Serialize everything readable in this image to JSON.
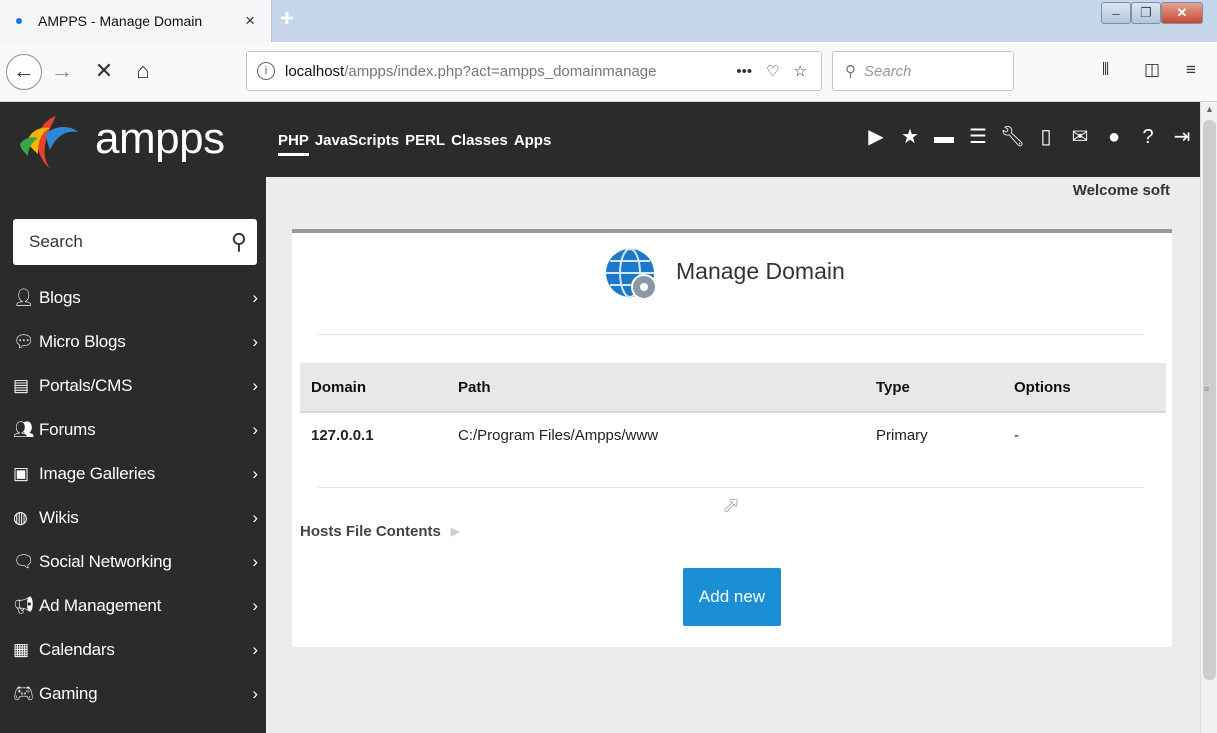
{
  "browser": {
    "tab_title": "AMPPS - Manage Domain",
    "tab_close": "×",
    "new_tab": "+",
    "url_host": "localhost",
    "url_path": "/ampps/index.php?act=ampps_domainmanage",
    "search_placeholder": "Search",
    "icons": [
      "back-icon",
      "forward-icon",
      "stop-icon",
      "home-icon",
      "info-icon",
      "page-actions-icon",
      "pocket-icon",
      "bookmark-star-icon",
      "search-icon",
      "library-icon",
      "sidebar-icon",
      "menu-icon"
    ]
  },
  "header": {
    "logo_text": "ampps",
    "nav": [
      "PHP",
      "JavaScripts",
      "PERL",
      "Classes",
      "Apps"
    ],
    "active_nav": "PHP",
    "icons": [
      "play-icon",
      "star-icon",
      "archive-icon",
      "list-icon",
      "wrench-icon",
      "file-icon",
      "mail-icon",
      "palette-icon",
      "help-icon",
      "logout-icon"
    ]
  },
  "sidebar": {
    "search_placeholder": "Search",
    "items": [
      {
        "label": "Blogs",
        "icon": "user-icon"
      },
      {
        "label": "Micro Blogs",
        "icon": "chat-bubbles-icon"
      },
      {
        "label": "Portals/CMS",
        "icon": "list-box-icon"
      },
      {
        "label": "Forums",
        "icon": "group-icon"
      },
      {
        "label": "Image Galleries",
        "icon": "image-icon"
      },
      {
        "label": "Wikis",
        "icon": "globe-icon"
      },
      {
        "label": "Social Networking",
        "icon": "comments-icon"
      },
      {
        "label": "Ad Management",
        "icon": "megaphone-icon"
      },
      {
        "label": "Calendars",
        "icon": "calendar-icon"
      },
      {
        "label": "Gaming",
        "icon": "gamepad-icon"
      }
    ]
  },
  "main": {
    "welcome": "Welcome soft",
    "title": "Manage Domain",
    "table": {
      "headers": [
        "Domain",
        "Path",
        "Type",
        "Options"
      ],
      "rows": [
        [
          "127.0.0.1",
          "C:/Program Files/Ampps/www",
          "Primary",
          "-"
        ]
      ]
    },
    "hosts_label": "Hosts File Contents",
    "add_button": "Add new"
  },
  "colors": {
    "header_bg": "#2b2b2b",
    "button_blue": "#1b8fd5",
    "tabbar": "#c6d6ea"
  }
}
